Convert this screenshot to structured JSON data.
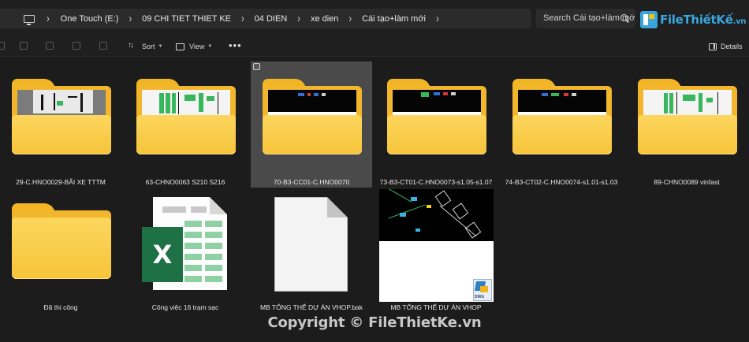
{
  "address_bar": {
    "crumbs": [
      "One Touch (E:)",
      "09 CHI TIET THIET KE",
      "04 DIEN",
      "xe dien",
      "Cái tạo+làm mới"
    ],
    "search_placeholder": "Search Cái tạo+làm mới"
  },
  "watermark": {
    "logo_text": "FileThiếtKế",
    "logo_domain": ".vn",
    "copyright": "Copyright © FileThietKe.vn"
  },
  "toolbar": {
    "sort_label": "Sort",
    "view_label": "View",
    "more_label": "•••",
    "details_label": "Details"
  },
  "items": [
    {
      "name": "29-C.HNO0029-BÃI XE TTTM",
      "type": "folder",
      "selected": false
    },
    {
      "name": "63-CHNO0063 S210 S216",
      "type": "folder",
      "selected": false
    },
    {
      "name": "70-B3-CC01-C.HNO0070",
      "type": "folder",
      "selected": true
    },
    {
      "name": "73-B3-CT01-C.HNO0073-s1.05-s1.07",
      "type": "folder",
      "selected": false
    },
    {
      "name": "74-B3-CT02-C.HNO0074-s1.01-s1.03",
      "type": "folder",
      "selected": false
    },
    {
      "name": "89-CHNO0089 vinfast",
      "type": "folder",
      "selected": false
    },
    {
      "name": "Đã thi công",
      "type": "folder",
      "selected": false
    },
    {
      "name": "Công việc 16 trạm sạc",
      "type": "excel",
      "selected": false
    },
    {
      "name": "MB TỔNG THỂ DỰ ÁN VHOP.bak",
      "type": "file",
      "selected": false
    },
    {
      "name": "MB TỔNG THỂ DỰ ÁN VHOP",
      "type": "dwg",
      "selected": false
    }
  ],
  "dwg_badge_label": "DWG",
  "colors": {
    "background": "#1c1c1c",
    "folder_yellow": "#f6c43a",
    "excel_green": "#1e7145",
    "selection": "#4a4a4a",
    "logo_blue": "#3aa5dd"
  }
}
